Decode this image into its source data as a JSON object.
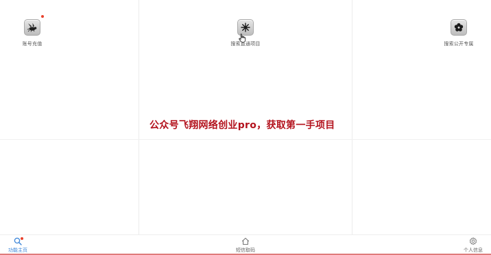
{
  "grid": {
    "tiles": [
      {
        "label": "账号充值",
        "icon": "wasp-icon",
        "badge": true
      },
      {
        "label": "搜索直通项目",
        "icon": "snowflake-gear-icon",
        "badge": false
      },
      {
        "label": "搜索公开专属",
        "icon": "flower-icon",
        "badge": false
      }
    ]
  },
  "watermark": {
    "text": "公众号飞翔网络创业pro，获取第一手项目"
  },
  "tabbar": {
    "tabs": [
      {
        "label": "功能主页",
        "icon": "search-icon",
        "active": true,
        "badge": true
      },
      {
        "label": "短信取码",
        "icon": "home-icon",
        "active": false,
        "badge": false
      },
      {
        "label": "个人信息",
        "icon": "settings-icon",
        "active": false,
        "badge": false
      }
    ]
  },
  "colors": {
    "accent": "#3a84d8",
    "badge": "#e8412c",
    "watermark": "#b3121d",
    "bottom_rule": "#e07b7b"
  }
}
